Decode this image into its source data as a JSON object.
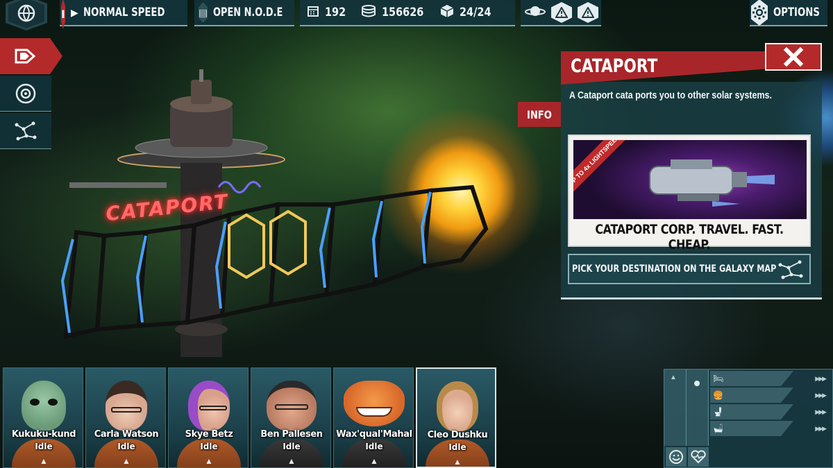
{
  "topbar": {
    "speed_label": "NORMAL SPEED",
    "speed_indicator": "I",
    "node_label": "OPEN N.O.D.E",
    "days": "192",
    "credits": "156626",
    "crew_capacity": "24/24",
    "options_label": "OPTIONS",
    "icons": {
      "globe": "globe-icon",
      "calendar": "calendar-icon",
      "coins": "coins-icon",
      "cube": "cube-icon",
      "planet": "planet-icon",
      "warning": "warning-icon",
      "gear": "gear-icon"
    }
  },
  "sidebar": {
    "items": [
      {
        "name": "build",
        "icon": "build-arrows-icon",
        "active": true
      },
      {
        "name": "system",
        "icon": "orbit-icon",
        "active": false
      },
      {
        "name": "galaxy",
        "icon": "network-icon",
        "active": false
      }
    ]
  },
  "info": {
    "title": "CATAPORT",
    "tag": "INFO",
    "description": "A Cataport cata ports you to other solar systems.",
    "ad_badge": "UP TO 4x LIGHTSPEED",
    "ad_slogan": "CATAPORT CORP. TRAVEL. FAST. CHEAP.",
    "destination_label": "PICK YOUR DESTINATION ON THE GALAXY MAP",
    "colors": {
      "accent_red": "#a8262a",
      "panel_teal": "#1a3e44"
    }
  },
  "station": {
    "neon_sign": "CATAPORT"
  },
  "crew": [
    {
      "name": "Kukuku-kund",
      "status": "Idle",
      "skin": "#7fa88a",
      "hair": "#7fa88a"
    },
    {
      "name": "Carla Watson",
      "status": "Idle",
      "skin": "#e8c0a8",
      "hair": "#3a2a22"
    },
    {
      "name": "Skye Betz",
      "status": "Idle",
      "skin": "#e8b8a0",
      "hair": "#9a4cc8"
    },
    {
      "name": "Ben Pallesen",
      "status": "Idle",
      "skin": "#d89a80",
      "hair": "#2a2a2a"
    },
    {
      "name": "Wax'qual'Mahal",
      "status": "Idle",
      "skin": "#e8782a",
      "hair": "#e8782a"
    },
    {
      "name": "Cleo Dushku",
      "status": "Idle",
      "skin": "#f0c8b0",
      "hair": "#b88a4a"
    }
  ],
  "needs": {
    "icons": [
      "bed-icon",
      "food-icon",
      "toilet-icon",
      "shower-icon",
      "mood-icon",
      "heart-icon"
    ]
  }
}
